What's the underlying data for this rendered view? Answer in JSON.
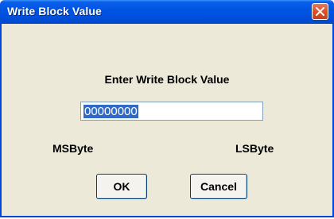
{
  "dialog": {
    "title": "Write Block Value",
    "prompt": "Enter Write Block Value",
    "value_field": {
      "value": "00000000",
      "selected": true
    },
    "labels": {
      "left": "MSByte",
      "right": "LSByte"
    },
    "buttons": {
      "ok": "OK",
      "cancel": "Cancel"
    }
  },
  "titlebar": {
    "close_icon": "close-icon"
  },
  "colors": {
    "titlebar": "#0054e3",
    "close_button": "#d9512c",
    "dialog_background": "#ece9d8",
    "selection": "#316ac5"
  }
}
